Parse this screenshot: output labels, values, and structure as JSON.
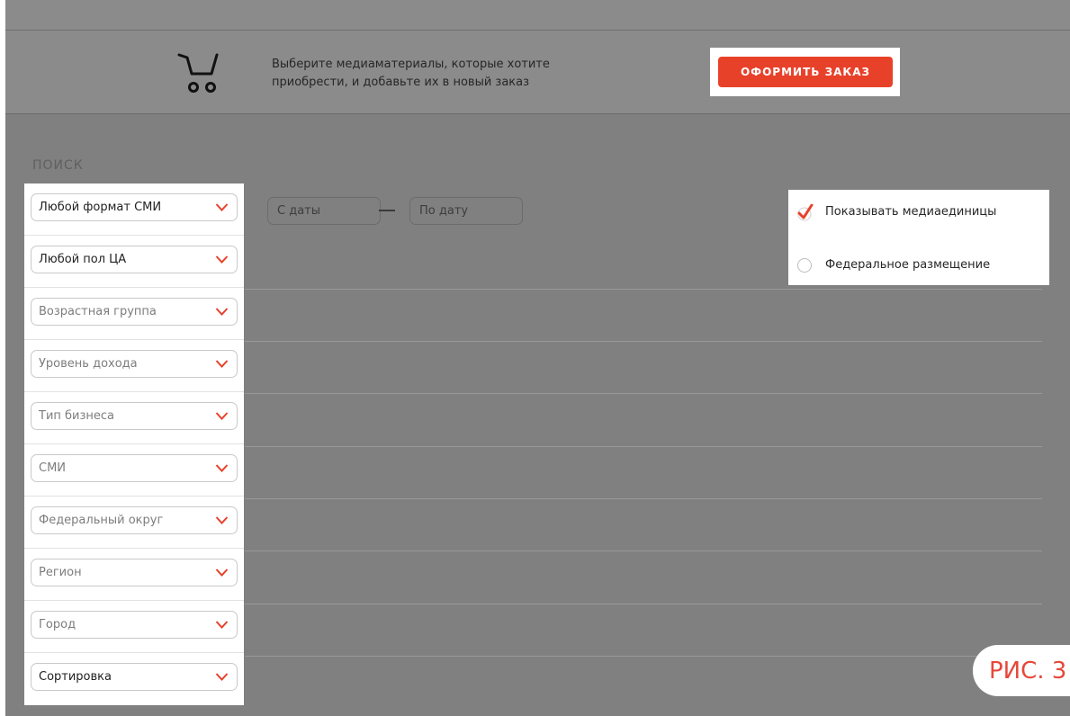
{
  "header": {
    "text_line1": "Выберите медиаматериалы, которые хотите",
    "text_line2": "приобрести, и добавьте их в новый заказ",
    "order_button_label": "ОФОРМИТЬ ЗАКАЗ",
    "cart_icon": "shopping-cart-icon"
  },
  "search": {
    "label": "ПОИСК",
    "filters": [
      {
        "label": "Любой формат СМИ",
        "muted": false
      },
      {
        "label": "Любой пол ЦА",
        "muted": false
      },
      {
        "label": "Возрастная группа",
        "muted": true
      },
      {
        "label": "Уровень дохода",
        "muted": true
      },
      {
        "label": "Тип бизнеса",
        "muted": true
      },
      {
        "label": "СМИ",
        "muted": true
      },
      {
        "label": "Федеральный округ",
        "muted": true
      },
      {
        "label": "Регион",
        "muted": true
      },
      {
        "label": "Город",
        "muted": true
      },
      {
        "label": "Сортировка",
        "muted": false
      }
    ],
    "date_from_placeholder": "С даты",
    "date_to_placeholder": "По дату"
  },
  "options": {
    "show_media_units": {
      "label": "Показывать медиаединицы",
      "checked": true
    },
    "federal_placement": {
      "label": "Федеральное размещение",
      "checked": false
    }
  },
  "figure_label": "РИС. 3",
  "colors": {
    "accent": "#e8412a",
    "overlay": "#808080",
    "header_bg": "#8b8b8b"
  }
}
